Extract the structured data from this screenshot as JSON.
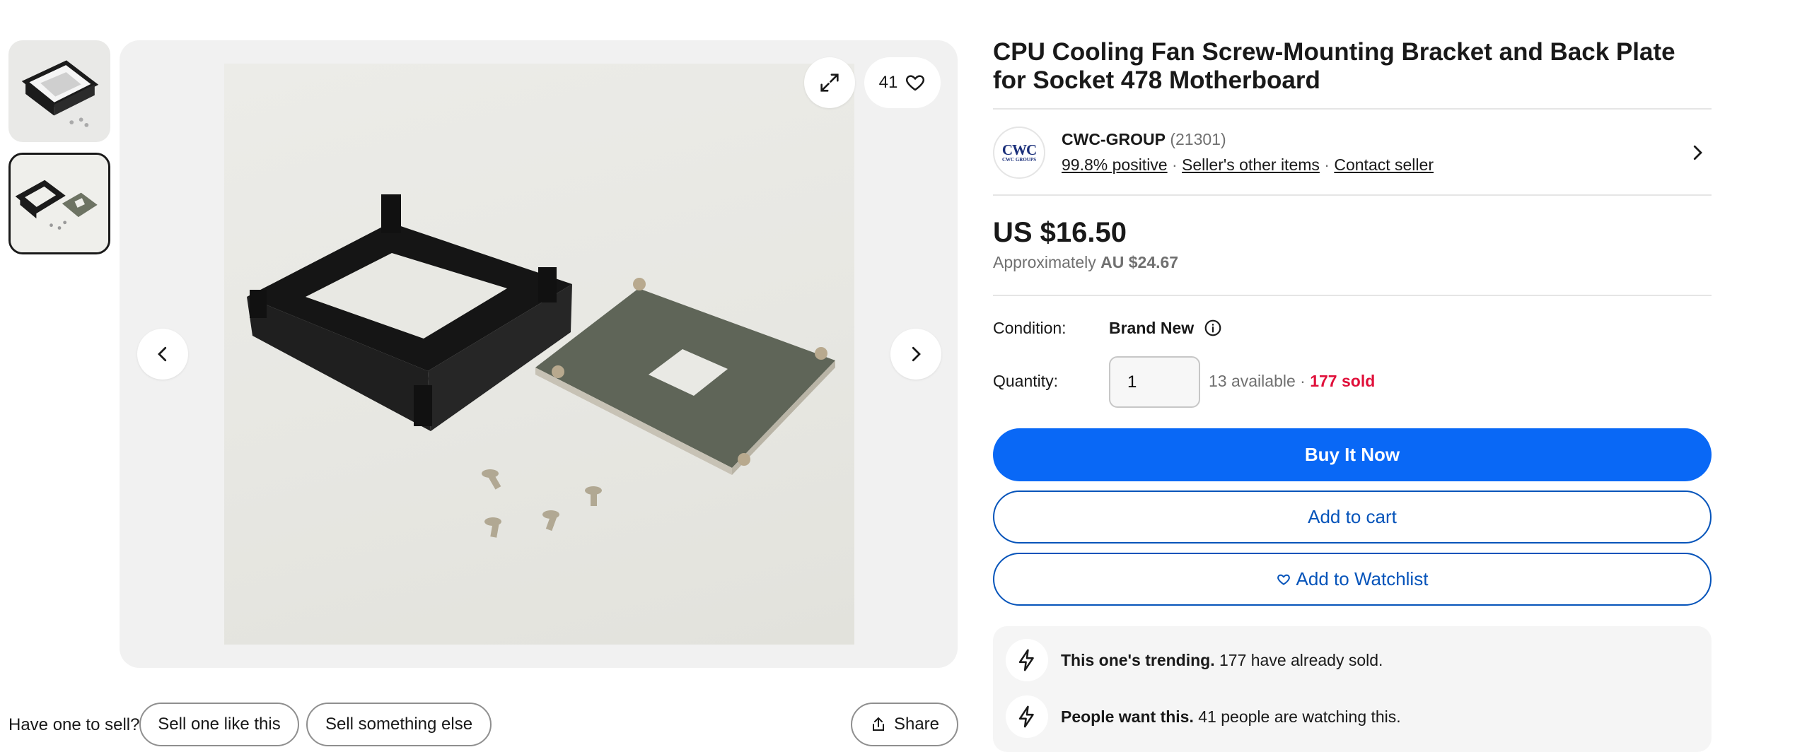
{
  "gallery": {
    "watch_count": "41",
    "thumbnails": [
      "thumbnail-1",
      "thumbnail-2"
    ]
  },
  "sell_row": {
    "label": "Have one to sell?",
    "sell_like": "Sell one like this",
    "sell_else": "Sell something else",
    "share": "Share"
  },
  "item": {
    "title": "CPU Cooling Fan Screw-Mounting Bracket and Back Plate for Socket 478 Motherboard",
    "price": "US $16.50",
    "approx_prefix": "Approximately",
    "approx_value": "AU $24.67",
    "condition_label": "Condition:",
    "condition_value": "Brand New",
    "quantity_label": "Quantity:",
    "quantity_value": "1",
    "available": "13 available",
    "separator": "·",
    "sold": "177 sold"
  },
  "seller": {
    "logo_text": "CWC",
    "logo_subtext": "CWC GROUPS",
    "name": "CWC-GROUP",
    "score": "(21301)",
    "positive": "99.8% positive",
    "other_items": "Seller's other items",
    "contact": "Contact seller",
    "separator": "·"
  },
  "actions": {
    "buy": "Buy It Now",
    "cart": "Add to cart",
    "watch": "Add to Watchlist"
  },
  "signals": [
    {
      "bold": "This one's trending.",
      "text": "177 have already sold."
    },
    {
      "bold": "People want this.",
      "text": "41 people are watching this."
    }
  ],
  "colors": {
    "primary": "#0968f6",
    "link": "#0654ba",
    "sold": "#e0103a",
    "text": "#191919",
    "muted": "#707070"
  }
}
